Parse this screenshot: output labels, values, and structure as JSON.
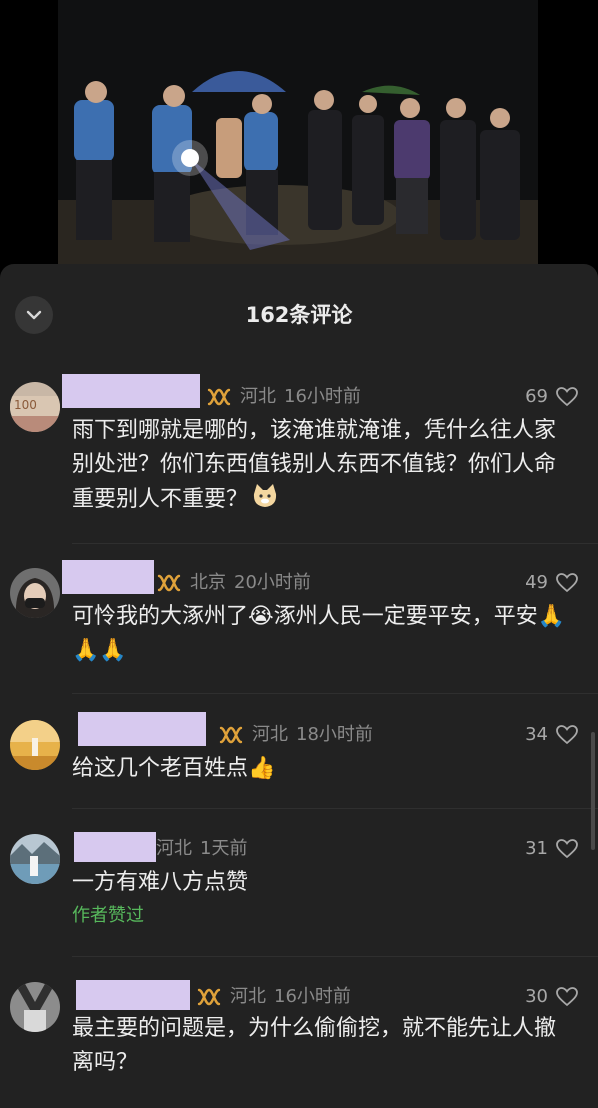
{
  "header": {
    "title": "162条评论"
  },
  "comments": [
    {
      "region": "河北",
      "time": "16小时前",
      "likes": "69",
      "text": "雨下到哪就是哪的，该淹谁就淹谁，凭什么往人家别处泄？你们东西值钱别人东西不值钱？你们人命重要别人不重要？",
      "emoji": "cat-face-emoji",
      "has_badge": true
    },
    {
      "region": "北京",
      "time": "20小时前",
      "likes": "49",
      "text": "可怜我的大涿州了😭涿州人民一定要平安，平安🙏🙏🙏",
      "has_badge": true
    },
    {
      "region": "河北",
      "time": "18小时前",
      "likes": "34",
      "text": "给这几个老百姓点👍",
      "has_badge": true
    },
    {
      "region": "河北",
      "time": "1天前",
      "likes": "31",
      "text": "一方有难八方点赞",
      "author_liked": "作者赞过",
      "has_badge": false
    },
    {
      "region": "河北",
      "time": "16小时前",
      "likes": "30",
      "text": "最主要的问题是，为什么偷偷挖，就不能先让人撤离吗？",
      "has_badge": true
    }
  ],
  "colors": {
    "sheet_bg": "#222222",
    "name_mask": "#d7c9ef",
    "badge": "#e0a23a",
    "author_liked": "#57b85c"
  },
  "icons": [
    "chevron-down-icon",
    "heart-outline-icon",
    "tag-badge-icon"
  ]
}
